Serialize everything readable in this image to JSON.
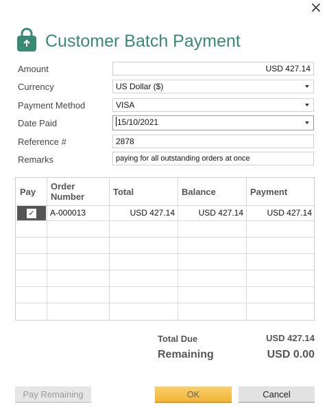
{
  "window": {
    "close_glyph": "×"
  },
  "header": {
    "title": "Customer Batch Payment",
    "icon": "shopping-bag-icon",
    "accent": "#3a8a73"
  },
  "form": {
    "amount_label": "Amount",
    "amount_value": "USD 427.14",
    "currency_label": "Currency",
    "currency_value": "US Dollar ($)",
    "method_label": "Payment Method",
    "method_value": "VISA",
    "date_label": "Date Paid",
    "date_value": "15/10/2021",
    "reference_label": "Reference #",
    "reference_value": "2878",
    "remarks_label": "Remarks",
    "remarks_value": "paying for all outstanding orders at once"
  },
  "table": {
    "headers": {
      "pay": "Pay",
      "order": "Order Number",
      "total": "Total",
      "balance": "Balance",
      "payment": "Payment"
    },
    "rows": [
      {
        "pay": true,
        "order": "A-000013",
        "total": "USD 427.14",
        "balance": "USD 427.14",
        "payment": "USD 427.14"
      }
    ]
  },
  "summary": {
    "total_due_label": "Total Due",
    "total_due_value": "USD 427.14",
    "remaining_label": "Remaining",
    "remaining_value": "USD 0.00"
  },
  "buttons": {
    "pay_remaining": "Pay Remaining",
    "ok": "OK",
    "cancel": "Cancel"
  }
}
